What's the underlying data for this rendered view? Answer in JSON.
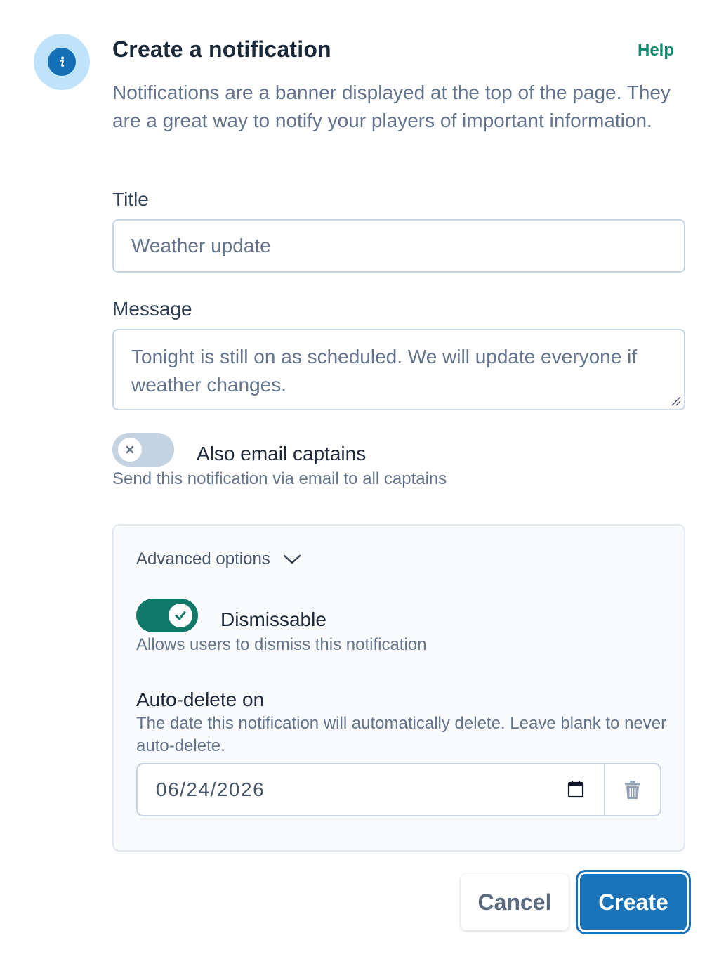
{
  "header": {
    "title": "Create a notification",
    "help_label": "Help",
    "description": "Notifications are a banner displayed at the top of the page. They are a great way to notify your players of important information.",
    "icon": "info-icon"
  },
  "form": {
    "title_label": "Title",
    "title_value": "Weather update",
    "message_label": "Message",
    "message_value": "Tonight is still on as scheduled. We will update everyone if weather changes.",
    "email_captains": {
      "label": "Also email captains",
      "description": "Send this notification via email to all captains",
      "enabled": false
    }
  },
  "advanced": {
    "label": "Advanced options",
    "dismissable": {
      "label": "Dismissable",
      "description": "Allows users to dismiss this notification",
      "enabled": true
    },
    "auto_delete": {
      "label": "Auto-delete on",
      "description": "The date this notification will automatically delete. Leave blank to never auto-delete.",
      "value": "06/24/2026"
    }
  },
  "actions": {
    "cancel_label": "Cancel",
    "create_label": "Create"
  },
  "colors": {
    "accent": "#1a72b8",
    "success": "#11786a",
    "help_link": "#0f8a6e"
  }
}
